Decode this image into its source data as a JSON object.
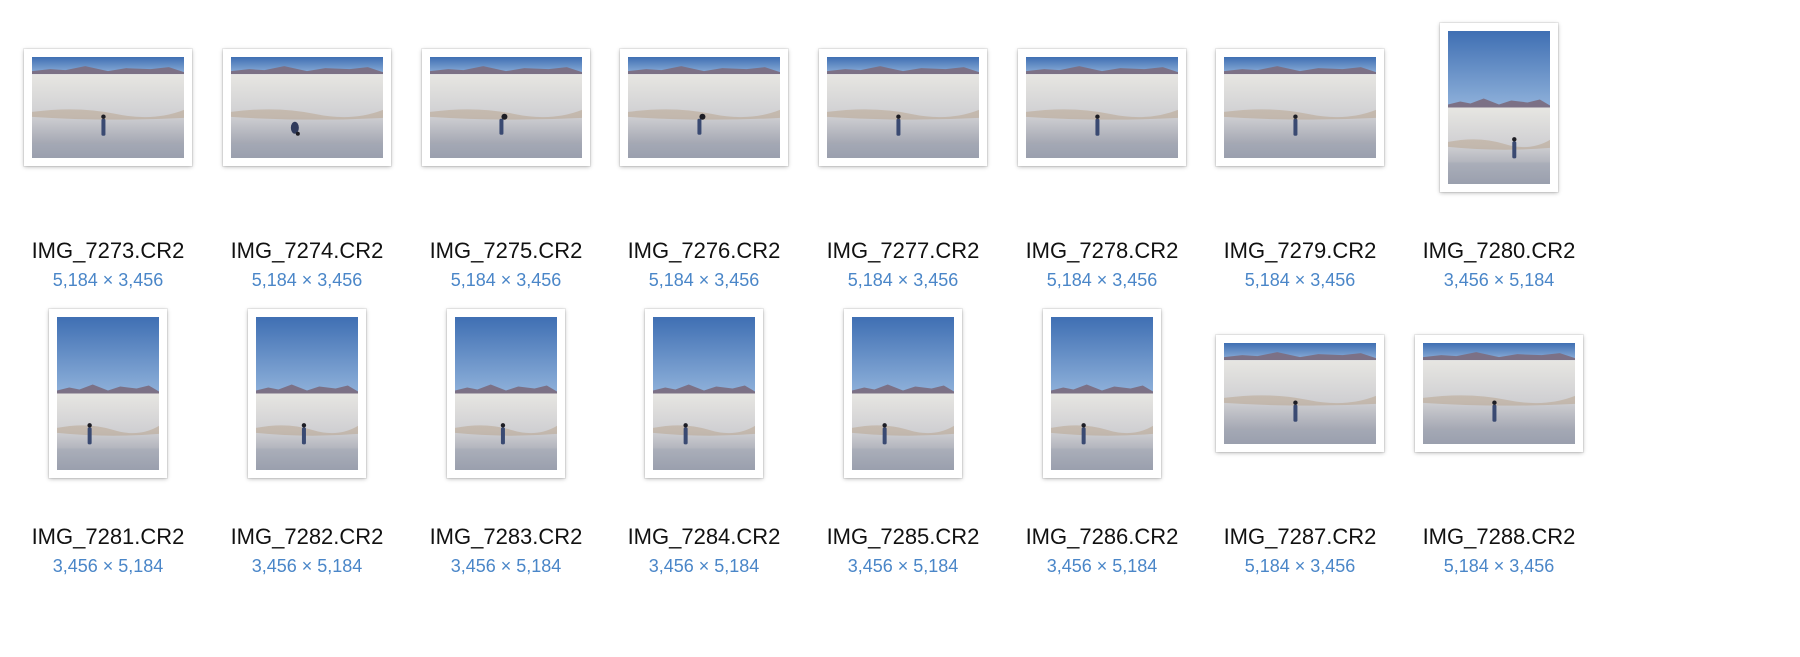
{
  "colors": {
    "filename_text": "#111111",
    "dimension_text": "#4a86c8",
    "sky": "#4f7fbf",
    "mountains": "#7c7186",
    "dunes": "#d9d9d9",
    "sand_shadow": "#a4a9b6"
  },
  "files": [
    {
      "name": "IMG_7273.CR2",
      "dimensions": "5,184 × 3,456",
      "orientation": "landscape",
      "figure": "standing-center",
      "icon": "photo-thumbnail-icon"
    },
    {
      "name": "IMG_7274.CR2",
      "dimensions": "5,184 × 3,456",
      "orientation": "landscape",
      "figure": "bending",
      "icon": "photo-thumbnail-icon"
    },
    {
      "name": "IMG_7275.CR2",
      "dimensions": "5,184 × 3,456",
      "orientation": "landscape",
      "figure": "hair-flip",
      "icon": "photo-thumbnail-icon"
    },
    {
      "name": "IMG_7276.CR2",
      "dimensions": "5,184 × 3,456",
      "orientation": "landscape",
      "figure": "hair-flip",
      "icon": "photo-thumbnail-icon"
    },
    {
      "name": "IMG_7277.CR2",
      "dimensions": "5,184 × 3,456",
      "orientation": "landscape",
      "figure": "standing-center",
      "icon": "photo-thumbnail-icon"
    },
    {
      "name": "IMG_7278.CR2",
      "dimensions": "5,184 × 3,456",
      "orientation": "landscape",
      "figure": "standing-center",
      "icon": "photo-thumbnail-icon"
    },
    {
      "name": "IMG_7279.CR2",
      "dimensions": "5,184 × 3,456",
      "orientation": "landscape",
      "figure": "standing-center",
      "icon": "photo-thumbnail-icon"
    },
    {
      "name": "IMG_7280.CR2",
      "dimensions": "3,456 × 5,184",
      "orientation": "portrait",
      "figure": "standing-right",
      "icon": "photo-thumbnail-icon"
    },
    {
      "name": "IMG_7281.CR2",
      "dimensions": "3,456 × 5,184",
      "orientation": "portrait",
      "figure": "standing-left",
      "icon": "photo-thumbnail-icon"
    },
    {
      "name": "IMG_7282.CR2",
      "dimensions": "3,456 × 5,184",
      "orientation": "portrait",
      "figure": "standing-center",
      "icon": "photo-thumbnail-icon"
    },
    {
      "name": "IMG_7283.CR2",
      "dimensions": "3,456 × 5,184",
      "orientation": "portrait",
      "figure": "standing-center",
      "icon": "photo-thumbnail-icon"
    },
    {
      "name": "IMG_7284.CR2",
      "dimensions": "3,456 × 5,184",
      "orientation": "portrait",
      "figure": "standing-left",
      "icon": "photo-thumbnail-icon"
    },
    {
      "name": "IMG_7285.CR2",
      "dimensions": "3,456 × 5,184",
      "orientation": "portrait",
      "figure": "standing-left",
      "icon": "photo-thumbnail-icon"
    },
    {
      "name": "IMG_7286.CR2",
      "dimensions": "3,456 × 5,184",
      "orientation": "portrait",
      "figure": "standing-left",
      "icon": "photo-thumbnail-icon"
    },
    {
      "name": "IMG_7287.CR2",
      "dimensions": "5,184 × 3,456",
      "orientation": "landscape",
      "figure": "standing-center",
      "icon": "photo-thumbnail-icon"
    },
    {
      "name": "IMG_7288.CR2",
      "dimensions": "5,184 × 3,456",
      "orientation": "landscape",
      "figure": "standing-center",
      "icon": "photo-thumbnail-icon"
    }
  ]
}
